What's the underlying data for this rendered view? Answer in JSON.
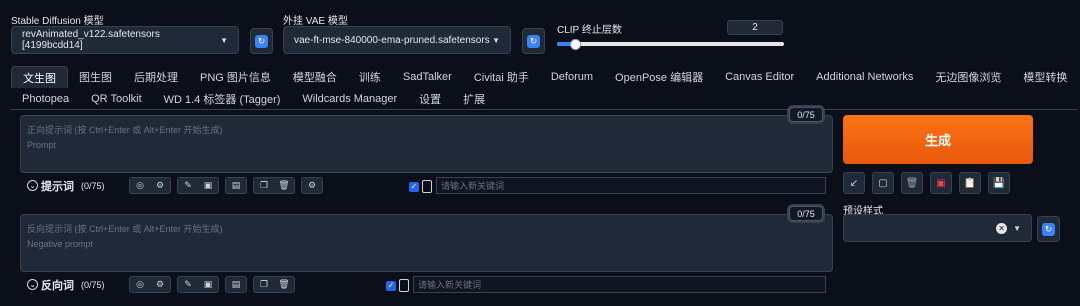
{
  "top": {
    "sd_model_label": "Stable Diffusion 模型",
    "sd_model_value": "revAnimated_v122.safetensors [4199bcdd14]",
    "vae_label": "外挂 VAE 模型",
    "vae_value": "vae-ft-mse-840000-ema-pruned.safetensors",
    "clip_label": "CLIP 终止层数",
    "clip_value": "2",
    "clip_slider_fraction": 0.08
  },
  "tabs": {
    "row1": [
      "文生图",
      "图生图",
      "后期处理",
      "PNG 图片信息",
      "模型融合",
      "训练",
      "SadTalker",
      "Civitai 助手",
      "Deforum",
      "OpenPose 编辑器",
      "Canvas Editor",
      "Additional Networks",
      "无边图像浏览",
      "模型转换"
    ],
    "row2": [
      "Photopea",
      "QR Toolkit",
      "WD 1.4 标签器 (Tagger)",
      "Wildcards Manager",
      "设置",
      "扩展"
    ],
    "active": "文生图"
  },
  "positive": {
    "hint_line1": "正向提示词 (按 Ctrl+Enter 或 Alt+Enter 开始生成)",
    "hint_line2": "Prompt",
    "counter": "0/75",
    "section_title": "提示词",
    "section_count": "(0/75)",
    "keyword_placeholder": "请输入新关键词"
  },
  "negative": {
    "hint_line1": "反向提示词 (按 Ctrl+Enter 或 Alt+Enter 开始生成)",
    "hint_line2": "Negative prompt",
    "counter": "0/75",
    "section_title": "反向词",
    "section_count": "(0/75)",
    "keyword_placeholder": "请输入新关键词"
  },
  "right": {
    "generate_label": "生成",
    "styles_label": "预设样式"
  },
  "colors": {
    "accent": "#3b82f6",
    "generate": "#ea580c",
    "background": "#0b0f19"
  }
}
